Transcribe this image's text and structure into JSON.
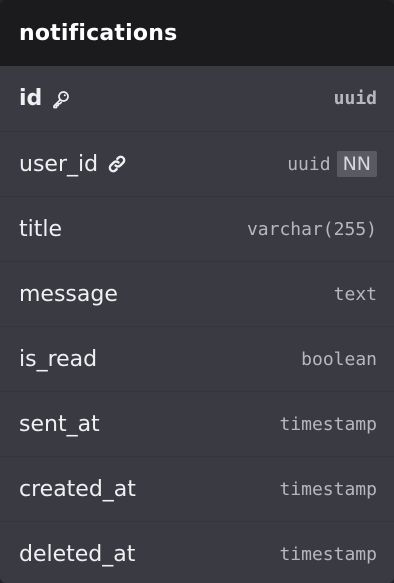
{
  "table": {
    "name": "notifications",
    "columns": [
      {
        "name": "id",
        "type": "uuid",
        "icon": "key-icon",
        "primary": true,
        "badge": ""
      },
      {
        "name": "user_id",
        "type": "uuid",
        "icon": "link-icon",
        "primary": false,
        "badge": "NN"
      },
      {
        "name": "title",
        "type": "varchar(255)",
        "icon": "",
        "primary": false,
        "badge": ""
      },
      {
        "name": "message",
        "type": "text",
        "icon": "",
        "primary": false,
        "badge": ""
      },
      {
        "name": "is_read",
        "type": "boolean",
        "icon": "",
        "primary": false,
        "badge": ""
      },
      {
        "name": "sent_at",
        "type": "timestamp",
        "icon": "",
        "primary": false,
        "badge": ""
      },
      {
        "name": "created_at",
        "type": "timestamp",
        "icon": "",
        "primary": false,
        "badge": ""
      },
      {
        "name": "deleted_at",
        "type": "timestamp",
        "icon": "",
        "primary": false,
        "badge": ""
      }
    ]
  },
  "colors": {
    "header_bg": "#1b1b1d",
    "body_bg": "#3a3b42",
    "text": "#f0f0f2",
    "type_text": "#b7b8be",
    "badge_bg": "#5a5b62"
  }
}
